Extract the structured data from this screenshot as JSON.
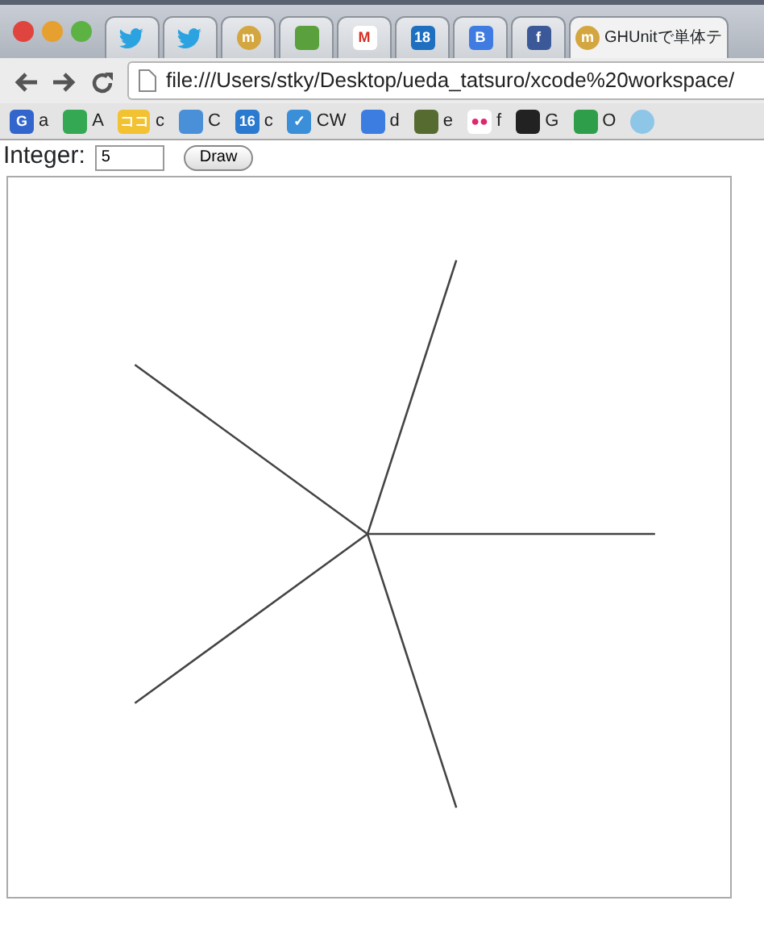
{
  "tabs": [
    {
      "kind": "bird",
      "selected": false
    },
    {
      "kind": "bird",
      "selected": false
    },
    {
      "kind": "badge",
      "glyph": "m",
      "color": "#d4a640",
      "selected": false
    },
    {
      "kind": "badge",
      "color": "#5aa03c",
      "selected": false
    },
    {
      "kind": "badge",
      "glyph": "M",
      "color": "#ffffff",
      "selected": false
    },
    {
      "kind": "badge",
      "glyph": "18",
      "color": "#1f6fc0",
      "selected": false
    },
    {
      "kind": "badge",
      "glyph": "B",
      "color": "#3f7be0",
      "selected": false
    },
    {
      "kind": "badge",
      "glyph": "f",
      "color": "#3b5998",
      "selected": false
    },
    {
      "kind": "titled",
      "glyph": "m",
      "color": "#d4a640",
      "title": "GHUnitで単体テ",
      "selected": true
    }
  ],
  "address": "file:///Users/stky/Desktop/ueda_tatsuro/xcode%20workspace/",
  "bookmarks": [
    {
      "glyph": "G",
      "color": "#3366cc",
      "label": "a"
    },
    {
      "color": "#34a853",
      "label": "A"
    },
    {
      "glyph": "ココ",
      "color": "#f2c233",
      "label": "c"
    },
    {
      "color": "#4a90d9",
      "label": "C"
    },
    {
      "glyph": "16",
      "color": "#2a7ad0",
      "label": "c"
    },
    {
      "glyph": "✓",
      "color": "#3a8fd8",
      "label": "CW"
    },
    {
      "color": "#3b7de0",
      "label": "d"
    },
    {
      "color": "#556b2f",
      "label": "e"
    },
    {
      "glyph": "●●",
      "color": "#ffffff",
      "label": "f"
    },
    {
      "color": "#222222",
      "label": "G"
    },
    {
      "color": "#2e9e4a",
      "label": "O"
    },
    {
      "color": "#8ec6e8"
    }
  ],
  "form": {
    "label": "Integer:",
    "value": "5",
    "button": "Draw"
  }
}
